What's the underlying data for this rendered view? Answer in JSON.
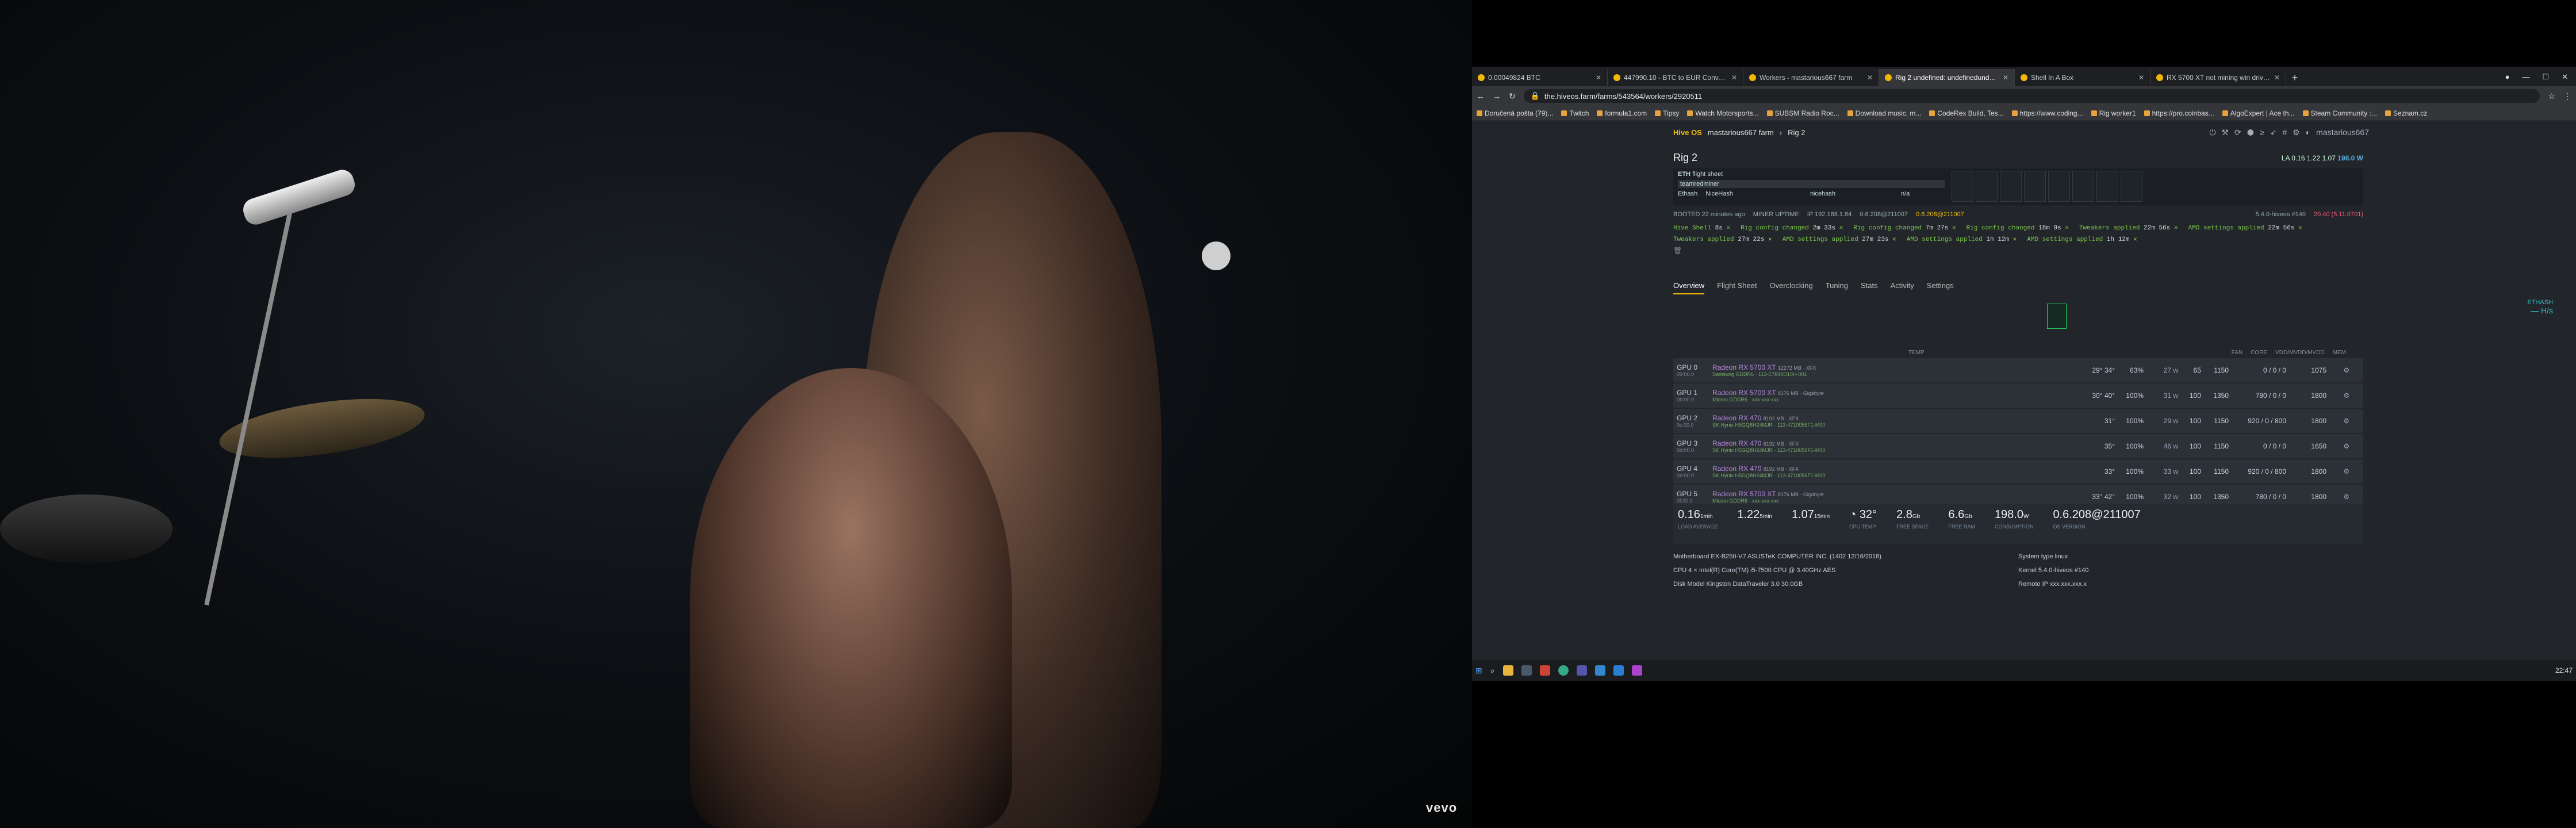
{
  "video": {
    "watermark": "vevo"
  },
  "browser": {
    "tabs": [
      {
        "title": "0.00049824 BTC",
        "active": false
      },
      {
        "title": "447990.10 - BTC to EUR Conversion",
        "active": false
      },
      {
        "title": "Workers - mastarious667 farm",
        "active": false
      },
      {
        "title": "Rig 2 undefined: undefinedundefined",
        "active": true
      },
      {
        "title": "Shell In A Box",
        "active": false
      },
      {
        "title": "RX 5700 XT not mining win drivers",
        "active": false
      }
    ],
    "url": "the.hiveos.farm/farms/543564/workers/2920511",
    "bookmarks": [
      "Doručená pošta (79)...",
      "Twitch",
      "formula1.com",
      "Tipsy",
      "Watch Motorsports...",
      "SUBSM Radio Roc...",
      "Download music, m...",
      "CodeRex Build, Tes...",
      "https://www.coding...",
      "Rig worker1",
      "https://pro.coinbas...",
      "AlgoExpert | Ace th...",
      "Steam Community :...",
      "Seznam.cz"
    ]
  },
  "hive": {
    "brand": "Hive OS",
    "farm": "mastarious667 farm",
    "rig": "Rig 2",
    "user": "mastarious667",
    "title": "Rig 2",
    "la_label": "LA",
    "la_values": "0.16 1.22 1.07",
    "power": "198.0 W",
    "fs_label": "ETH",
    "fs_sub": "flight sheet",
    "miner": "teamredminer",
    "coin": "Ethash",
    "pool": "NiceHash",
    "wallet": "nicehash",
    "na": "n/a",
    "booted": "BOOTED",
    "booted_val": "22 minutes ago",
    "uptime": "MINER UPTIME",
    "ip": "IP 192.168.1.84",
    "ver": "0.6.208@211007",
    "ver_red": "0.6.208@211007",
    "drivers": "5.4.0-hiveos #140",
    "amd": "20.40 (5.11.0701)",
    "events": [
      {
        "t": "Hive Shell",
        "tm": "8s"
      },
      {
        "t": "Rig config changed",
        "tm": "2m 33s"
      },
      {
        "t": "Rig config changed",
        "tm": "7m 27s"
      },
      {
        "t": "Rig config changed",
        "tm": "18m 9s"
      },
      {
        "t": "Tweakers applied",
        "tm": "22m 56s"
      },
      {
        "t": "AMD settings applied",
        "tm": "22m 56s"
      },
      {
        "t": "Tweakers applied",
        "tm": "27m 22s"
      },
      {
        "t": "AMD settings applied",
        "tm": "27m 23s"
      },
      {
        "t": "AMD settings applied",
        "tm": "1h 12m"
      },
      {
        "t": "AMD settings applied",
        "tm": "1h 12m"
      }
    ],
    "nav": [
      "Overview",
      "Flight Sheet",
      "Overclocking",
      "Tuning",
      "Stats",
      "Activity",
      "Settings"
    ],
    "hash_algo": "ETHASH",
    "hash_val": "— H/s",
    "gpu_headers": [
      "TEMP",
      "FAN",
      "CORE",
      "VDD/MVDD/MVDD",
      "MEM"
    ],
    "gpus": [
      {
        "id": "GPU 0",
        "bus": "09:00.0",
        "model": "Radeon RX 5700 XT",
        "mem": "12272 MB · XFX",
        "vram": "Samsung GDDR6 · 113-E7840D10H-001",
        "temp": "29° 34°",
        "fan": "63%",
        "pow": "27 w",
        "c1": "65",
        "core": "1150",
        "vdd": "0 / 0 / 0",
        "memc": "1075"
      },
      {
        "id": "GPU 1",
        "bus": "0b:00.0",
        "model": "Radeon RX 5700 XT",
        "mem": "8176 MB · Gigabyte",
        "vram": "Micron GDDR6 · xxx-xxx-xxx",
        "temp": "30° 40°",
        "fan": "100%",
        "pow": "31 w",
        "c1": "100",
        "core": "1350",
        "vdd": "780 / 0 / 0",
        "memc": "1800"
      },
      {
        "id": "GPU 2",
        "bus": "0c:00.0",
        "model": "Radeon RX 470",
        "mem": "8192 MB · XFX",
        "vram": "SK Hynix H5GQ8H24MJR · 113-4710056F1-M00",
        "temp": "31°",
        "fan": "100%",
        "pow": "29 w",
        "c1": "100",
        "core": "1150",
        "vdd": "920 / 0 / 800",
        "memc": "1800"
      },
      {
        "id": "GPU 3",
        "bus": "0d:00.0",
        "model": "Radeon RX 470",
        "mem": "8192 MB · XFX",
        "vram": "SK Hynix H5GQ8H24MJR · 113-4710056F1-M00",
        "temp": "35°",
        "fan": "100%",
        "pow": "46 w",
        "c1": "100",
        "core": "1150",
        "vdd": "0 / 0 / 0",
        "memc": "1650"
      },
      {
        "id": "GPU 4",
        "bus": "0e:00.0",
        "model": "Radeon RX 470",
        "mem": "8192 MB · XFX",
        "vram": "SK Hynix H5GQ8H24MJR · 113-4710056F1-M00",
        "temp": "33°",
        "fan": "100%",
        "pow": "33 w",
        "c1": "100",
        "core": "1150",
        "vdd": "920 / 0 / 800",
        "memc": "1800"
      },
      {
        "id": "GPU 5",
        "bus": "0f:00.0",
        "model": "Radeon RX 5700 XT",
        "mem": "8176 MB · Gigabyte",
        "vram": "Micron GDDR6 · xxx-xxx-xxx",
        "temp": "33° 42°",
        "fan": "100%",
        "pow": "32 w",
        "c1": "100",
        "core": "1350",
        "vdd": "780 / 0 / 0",
        "memc": "1800"
      }
    ],
    "stats": [
      {
        "v": "0.16",
        "u": "1min",
        "l": "LOAD AVERAGE"
      },
      {
        "v": "1.22",
        "u": "5min",
        "l": ""
      },
      {
        "v": "1.07",
        "u": "15min",
        "l": ""
      },
      {
        "v": "32°",
        "u": "",
        "l": "CPU TEMP"
      },
      {
        "v": "2.8",
        "u": "Gb",
        "l": "FREE SPACE"
      },
      {
        "v": "6.6",
        "u": "Gb",
        "l": "FREE RAM"
      },
      {
        "v": "198.0",
        "u": "W",
        "l": "CONSUMPTION"
      },
      {
        "v": "0.6.208@211007",
        "u": "",
        "l": "OS VERSION"
      }
    ],
    "specs": {
      "motherboard": "Motherboard  EX-B250-V7 ASUSTeK COMPUTER INC. (1402 12/16/2018)",
      "cpu": "CPU  4 × Intel(R) Core(TM) i5-7500 CPU @ 3.40GHz AES",
      "disk": "Disk Model  Kingston DataTraveler 3.0 30.0GB",
      "system": "System type  linux",
      "kernel": "Kernel  5.4.0-hiveos #140",
      "remote": "Remote IP  xxx.xxx.xxx.x"
    }
  },
  "taskbar": {
    "time": "22:47"
  }
}
